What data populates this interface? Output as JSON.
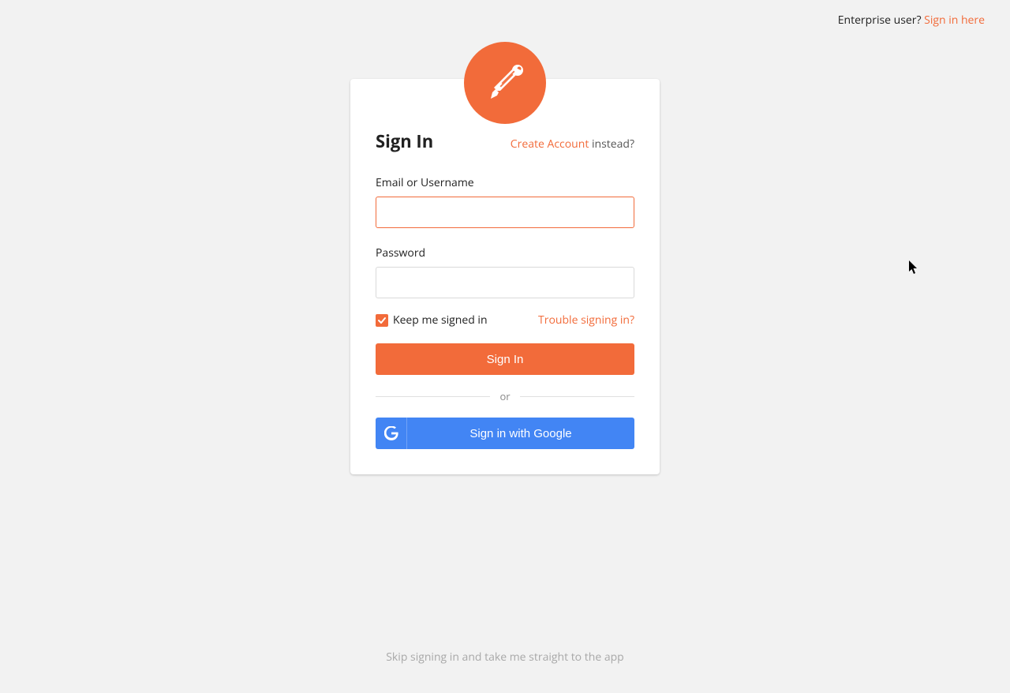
{
  "top": {
    "enterprise_prompt": "Enterprise user? ",
    "enterprise_link": "Sign in here"
  },
  "card": {
    "title": "Sign In",
    "create_account_link": "Create Account",
    "instead_text": " instead?",
    "email_label": "Email or Username",
    "email_value": "",
    "password_label": "Password",
    "password_value": "",
    "keep_signed_in_label": "Keep me signed in",
    "trouble_link": "Trouble signing in?",
    "signin_button": "Sign In",
    "divider_text": "or",
    "google_button": "Sign in with Google"
  },
  "footer": {
    "skip_link": "Skip signing in and take me straight to the app"
  },
  "colors": {
    "accent": "#f26b3a",
    "google_blue": "#4285f4",
    "bg": "#f2f2f2"
  },
  "icons": {
    "logo": "postman-rocket-icon",
    "checkbox": "check-icon",
    "google": "google-g-icon"
  }
}
